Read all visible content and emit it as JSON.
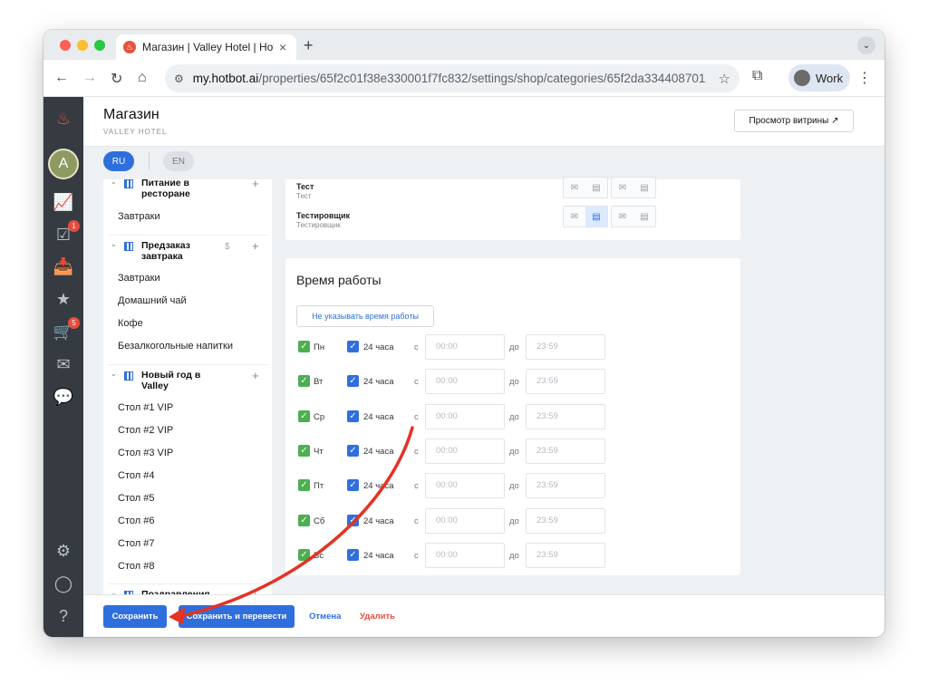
{
  "browser": {
    "tab_title": "Магазин | Valley Hotel | Hotbo",
    "tab_close": "×",
    "new_tab": "+",
    "tab_menu": "⌄",
    "url_host": "my.hotbot.ai",
    "url_path": "/properties/65f2c01f38e330001f7fc832/settings/shop/categories/65f2da334408701...",
    "profile_label": "Work",
    "nav": {
      "back": "←",
      "forward": "→",
      "reload": "↻",
      "home": "⌂",
      "star": "☆",
      "kebab": "⋮",
      "extensions": "⧉",
      "site_info": "⚙"
    }
  },
  "rail": {
    "logo": "♨",
    "avatar": "A",
    "icons": [
      {
        "name": "analytics-icon",
        "glyph": "📈"
      },
      {
        "name": "tasks-icon",
        "glyph": "☑",
        "badge": "1"
      },
      {
        "name": "inbox-icon",
        "glyph": "📥"
      },
      {
        "name": "reviews-icon",
        "glyph": "★"
      },
      {
        "name": "shop-cart-icon",
        "glyph": "🛒",
        "badge": "5"
      },
      {
        "name": "mailing-icon",
        "glyph": "✉"
      },
      {
        "name": "chat-icon",
        "glyph": "💬"
      }
    ],
    "bottom": {
      "settings": "⚙",
      "profile": "◯",
      "help": "?"
    }
  },
  "header": {
    "title": "Магазин",
    "subtitle": "VALLEY HOTEL",
    "showcase_button": "Просмотр витрины ↗"
  },
  "languages": {
    "ru": "RU",
    "en": "EN"
  },
  "categories": {
    "groups": [
      {
        "title": "Питание в ресторане",
        "items": [
          "Завтраки"
        ]
      },
      {
        "title": "Предзаказ завтрака",
        "dollar": "$",
        "items": [
          "Завтраки",
          "Домашний чай",
          "Кофе",
          "Безалкогольные напитки"
        ]
      },
      {
        "title": "Новый год в Valley",
        "items": [
          "Стол #1 VIP",
          "Стол #2 VIP",
          "Стол #3 VIP",
          "Стол #4",
          "Стол #5",
          "Стол #6",
          "Стол #7",
          "Стол #8"
        ]
      },
      {
        "title": "Поздравления",
        "items": []
      }
    ],
    "plus": "+",
    "chevron": "⌄"
  },
  "notifications": {
    "people": [
      {
        "name": "Тест",
        "role": "Тест",
        "email": "✉",
        "chat": "▤"
      },
      {
        "name": "Тестировщик",
        "role": "Тестировщик",
        "email": "✉",
        "chat": "▤"
      }
    ]
  },
  "hours": {
    "title": "Время работы",
    "no_hours_button": "Не указывать время работы",
    "days": [
      "Пн",
      "Вт",
      "Ср",
      "Чт",
      "Пт",
      "Сб",
      "Вс"
    ],
    "h24_label": "24 часа",
    "from_label": "с",
    "to_label": "до",
    "from_placeholder": "00:00",
    "to_placeholder": "23:59",
    "check": "✓"
  },
  "actions": {
    "save": "Сохранить",
    "save_translate": "Сохранить и перевести",
    "cancel": "Отмена",
    "delete": "Удалить"
  },
  "colors": {
    "accent": "#2f6fdd",
    "danger": "#e84c3d",
    "annotation_arrow": "#e53224"
  }
}
